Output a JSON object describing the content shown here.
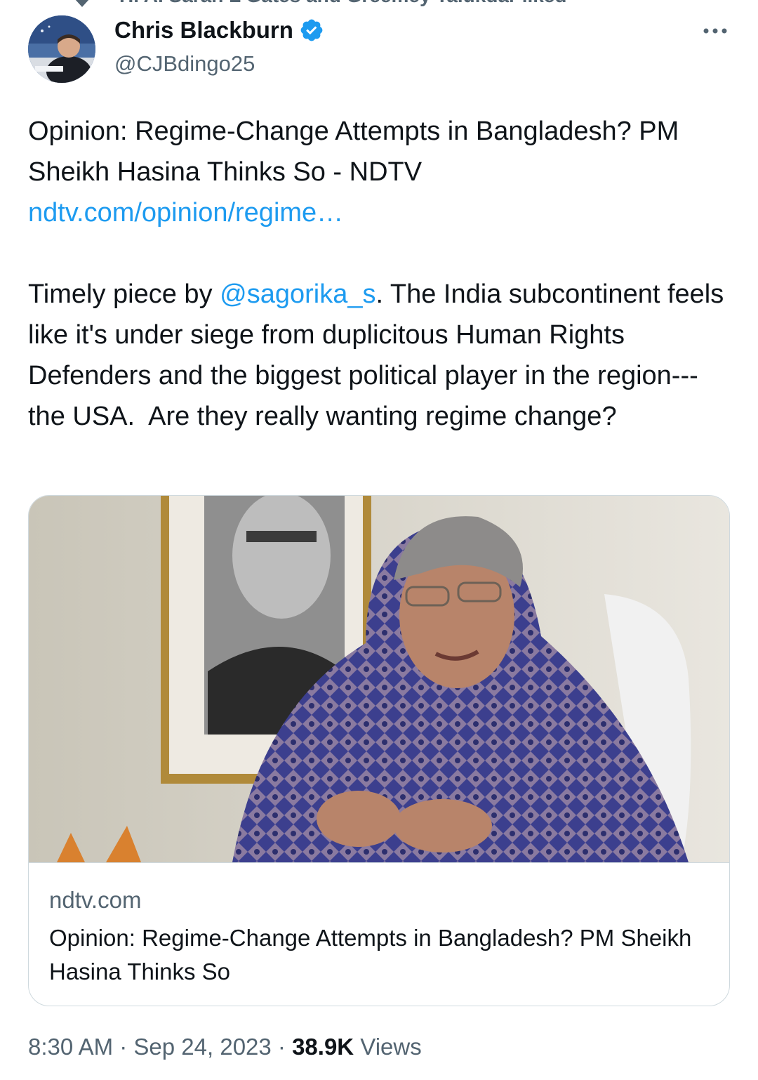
{
  "social_context": "H. A. Sarah L Gates and Greemey Talukdar liked",
  "author": {
    "name": "Chris Blackburn",
    "handle": "@CJBdingo25",
    "verified": true
  },
  "tweet": {
    "line1": "Opinion: Regime-Change Attempts in Bangladesh? PM Sheikh Hasina Thinks So - NDTV",
    "url_text": "ndtv.com/opinion/regime…",
    "body_before_mention": "Timely piece by ",
    "mention": "@sagorika_s",
    "body_after_mention": ". The India subcontinent feels like it's under siege from duplicitous Human Rights Defenders and the biggest political player in the region--- the USA.  Are they really wanting regime change?"
  },
  "card": {
    "domain": "ndtv.com",
    "title": "Opinion: Regime-Change Attempts in Bangladesh? PM Sheikh Hasina Thinks So"
  },
  "meta": {
    "time": "8:30 AM",
    "separator": " · ",
    "date": "Sep 24, 2023",
    "views_count": "38.9K",
    "views_label": " Views"
  },
  "colors": {
    "link": "#1d9bf0",
    "secondary_text": "#536471",
    "border": "#cfd9de",
    "verified": "#1d9bf0"
  },
  "icons": [
    "heart-icon",
    "verified-badge-icon",
    "more-options-icon"
  ]
}
